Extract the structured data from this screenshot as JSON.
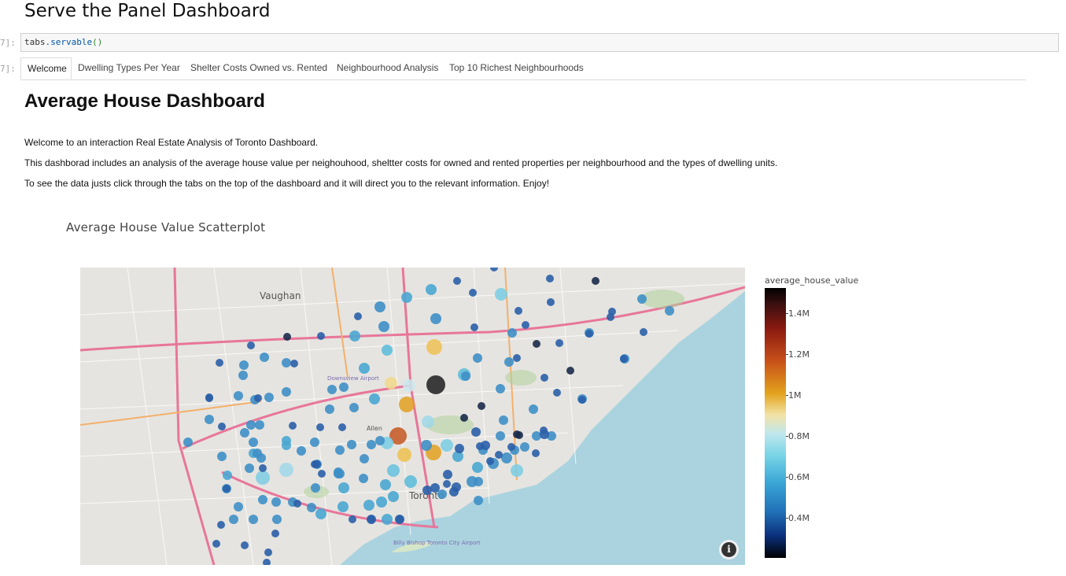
{
  "notebook": {
    "heading": "Serve the Panel Dashboard",
    "input_prompt": "7]:",
    "output_prompt": "7]:",
    "code": {
      "object": "tabs",
      "method": ".servable",
      "parens": "()"
    }
  },
  "tabs": [
    {
      "label": "Welcome",
      "active": true
    },
    {
      "label": "Dwelling Types Per Year",
      "active": false
    },
    {
      "label": "Shelter Costs Owned vs. Rented",
      "active": false
    },
    {
      "label": "Neighbourhood Analysis",
      "active": false
    },
    {
      "label": "Top 10 Richest Neighbourhoods",
      "active": false
    }
  ],
  "dashboard": {
    "title": "Average House Dashboard",
    "paragraphs": [
      "Welcome to an interaction Real Estate Analysis of Toronto Dashboard.",
      "This dashborad includes an analysis of the average house value per neighouhood, sheltter costs for owned and rented properties per neighbourhood and the types of dwelling units.",
      "To see the data justs click through the tabs on the top of the dashboard and it will direct you to the relevant information. Enjoy!"
    ]
  },
  "plot": {
    "title": "Average House Value Scatterplot",
    "info_glyph": "i",
    "map_labels": [
      "Vaughan",
      "Downsview Airport",
      "Toronto",
      "Billy Bishop Toronto City Airport",
      "Allen"
    ],
    "colorbar": {
      "title": "average_house_value",
      "ticks": [
        "1.4M",
        "1.2M",
        "1M",
        "0.8M",
        "0.6M",
        "0.4M"
      ]
    }
  },
  "colors": {
    "water": "#aad3df",
    "land": "#e6e4e0",
    "highway": "#e8769a",
    "dark_point": "#1e3f73",
    "light_point": "#7ecde3",
    "hot_point": "#e2a021"
  }
}
